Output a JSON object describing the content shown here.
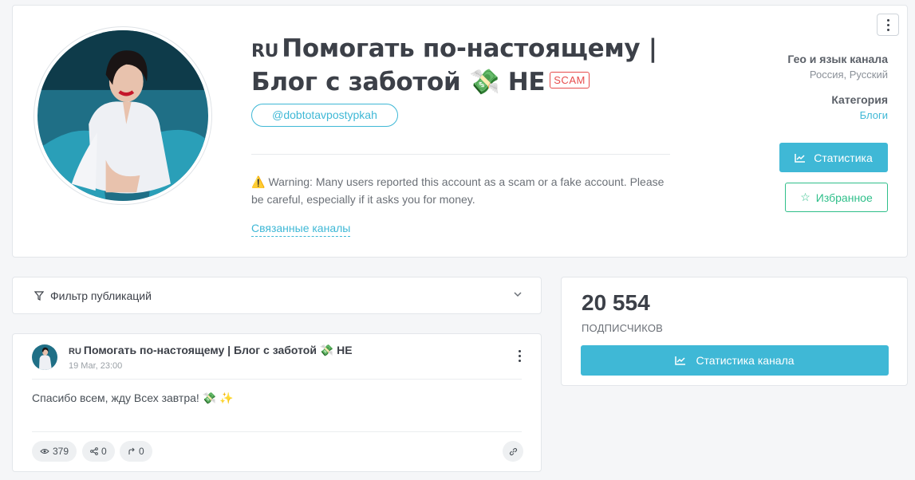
{
  "channel": {
    "flag": "RU",
    "title": "Помогать по-настоящему | Блог с заботой 💸 НЕ",
    "scam_badge": "SCAM",
    "username": "@dobtotavpostypkah",
    "warning": "Warning: Many users reported this account as a scam or a fake account. Please be careful, especially if it asks you for money.",
    "related_link": "Связанные каналы"
  },
  "meta": {
    "geo_label": "Гео и язык канала",
    "geo_value": "Россия, Русский",
    "category_label": "Категория",
    "category_value": "Блоги"
  },
  "buttons": {
    "stats": "Статистика",
    "favorite": "Избранное",
    "channel_stats": "Статистика канала"
  },
  "filter": {
    "label": "Фильтр публикаций"
  },
  "post": {
    "flag": "RU",
    "title": "Помогать по-настоящему | Блог с заботой 💸 НЕ",
    "date": "19 Mar, 23:00",
    "text": "Спасибо всем, жду Всех завтра! 💸 ✨",
    "views": "379",
    "shares": "0",
    "forwards": "0"
  },
  "subscribers": {
    "count": "20 554",
    "label": "ПОДПИСЧИКОВ"
  },
  "colors": {
    "accent": "#3fb8d6",
    "favorite": "#2fbf8a",
    "scam": "#e74c4c"
  }
}
